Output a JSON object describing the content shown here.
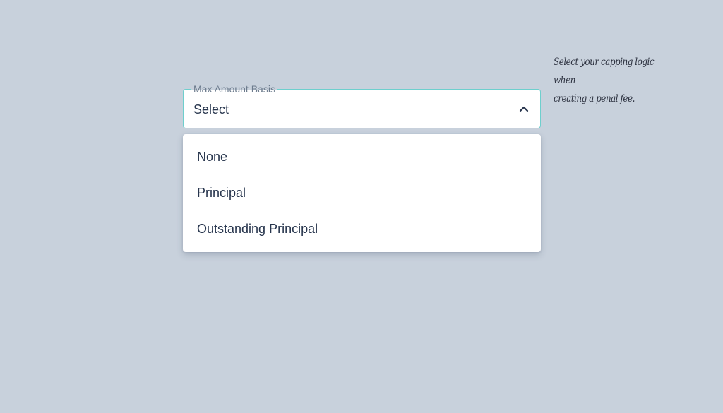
{
  "select": {
    "label": "Max Amount Basis",
    "value": "Select",
    "icon": "chevron-up-icon",
    "accent_color": "#6ecfcd"
  },
  "menu": {
    "options": [
      {
        "label": "None"
      },
      {
        "label": "Principal"
      },
      {
        "label": "Outstanding Principal"
      }
    ]
  },
  "hint": {
    "line1": "Select your capping logic when",
    "line2": "creating a penal fee."
  }
}
